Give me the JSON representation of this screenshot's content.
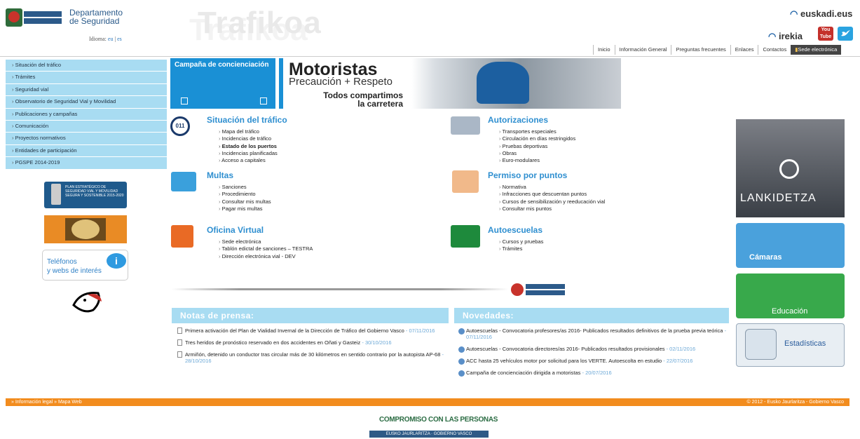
{
  "header": {
    "gov_logo": "Eusko Jaurlaritza Gobierno Vasco",
    "department": [
      "Departamento",
      "de Seguridad"
    ],
    "site_title": "Trafikoa",
    "language_label": "Idioma:",
    "lang_eu": "eu",
    "lang_sep": "|",
    "lang_es": "es",
    "euskadi": "euskadi.eus",
    "irekia": "irekia",
    "youtube": "You Tube"
  },
  "topnav": [
    "Inicio",
    "Información General",
    "Preguntas frecuentes",
    "Enlaces",
    "Contactos",
    "Sede electrónica"
  ],
  "sidebar": [
    "Situación del tráfico",
    "Trámites",
    "Seguridad vial",
    "Observatorio de Seguridad Vial y Movilidad",
    "Publicaciones y campañas",
    "Comunicación",
    "Proyectos normativos",
    "Entidades de participación",
    "PGSPE 2014-2019"
  ],
  "plan": "PLAN ESTRATÉGICO DE SEGURIDAD VIAL Y MOVILIDAD SEGURA Y SOSTENIBLE 2015-2020",
  "telefonos": [
    "Teléfonos",
    "y webs de interés"
  ],
  "campaign": {
    "label": "Campaña de concienciación",
    "title": "Motoristas",
    "subtitle": "Precaución + Respeto",
    "tag1": "Todos compartimos",
    "tag2": "la carretera"
  },
  "sections": {
    "trafico": {
      "title": "Situación del tráfico",
      "icon": "011",
      "items": [
        "Mapa del tráfico",
        "Incidencias de tráfico",
        "Estado de los puertos",
        "Incidencias planificadas",
        "Acceso a capitales"
      ]
    },
    "autorizaciones": {
      "title": "Autorizaciones",
      "items": [
        "Transportes especiales",
        "Circulación en días restringidos",
        "Pruebas deportivas",
        "Obras",
        "Euro-modulares"
      ]
    },
    "multas": {
      "title": "Multas",
      "items": [
        "Sanciones",
        "Procedimiento",
        "Consultar mis multas",
        "Pagar mis multas"
      ]
    },
    "permiso": {
      "title": "Permiso por puntos",
      "items": [
        "Normativa",
        "Infracciones que descuentan puntos",
        "Cursos de sensibilización y reeducación vial",
        "Consultar mis puntos"
      ]
    },
    "oficina": {
      "title": "Oficina Virtual",
      "items": [
        "Sede electrónica",
        "Tablón edictal de sanciones – TESTRA",
        "Dirección electrónica vial - DEV"
      ]
    },
    "autoescuelas": {
      "title": "Autoescuelas",
      "items": [
        "Cursos y pruebas",
        "Trámites"
      ]
    }
  },
  "right": {
    "lankidetza": "LANKIDETZA",
    "camaras": "Cámaras",
    "educacion": "Educación",
    "estadisticas": "Estadísticas"
  },
  "notas": {
    "title": "Notas de prensa:",
    "items": [
      {
        "text": "Primera activación del Plan de Vialidad Invernal de la Dirección de Tráfico del Gobierno Vasco",
        "date": "- 07/11/2016"
      },
      {
        "text": "Tres heridos de pronóstico reservado en dos accidentes en Oñati y Gasteiz",
        "date": "- 30/10/2016"
      },
      {
        "text": "Armiñón, detenido un conductor tras circular más de 30 kilómetros en sentido contrario por la autopista AP-68",
        "date": "- 28/10/2016"
      }
    ]
  },
  "novedades": {
    "title": "Novedades:",
    "items": [
      {
        "text": "Autoescuelas - Convocatoria profesores/as 2016- Publicados resultados definitivos de la prueba previa teórica",
        "date": "- 07/11/2016"
      },
      {
        "text": "Autoescuelas - Convocatoria directores/as 2016- Publicados resultados provisionales",
        "date": "- 02/11/2016"
      },
      {
        "text": "ACC hasta 25 vehículos motor por solicitud para los VERTE. Autoescolta en estudio",
        "date": "- 22/07/2016"
      },
      {
        "text": "Campaña de concienciación dirigida a motoristas",
        "date": "- 20/07/2016"
      }
    ]
  },
  "footer": {
    "legal": "» Información legal",
    "mapa": "» Mapa Web",
    "copyright": "© 2012 - Eusko Jaurlaritza - Gobierno Vasco",
    "compromiso": "COMPROMISO CON LAS PERSONAS",
    "gv": "EUSKO JAURLARITZA · GOBIERNO VASCO"
  }
}
